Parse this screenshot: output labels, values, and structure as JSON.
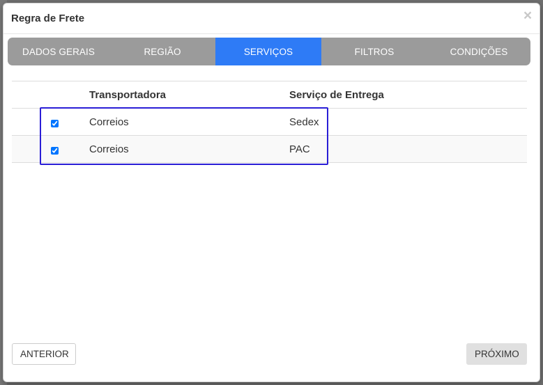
{
  "modal": {
    "title": "Regra de Frete",
    "close_label": "×"
  },
  "tabs": [
    {
      "label": "DADOS GERAIS",
      "active": false
    },
    {
      "label": "REGIÃO",
      "active": false
    },
    {
      "label": "SERVIÇOS",
      "active": true
    },
    {
      "label": "FILTROS",
      "active": false
    },
    {
      "label": "CONDIÇÕES",
      "active": false
    }
  ],
  "table": {
    "headers": [
      "",
      "Transportadora",
      "Serviço de Entrega"
    ],
    "rows": [
      {
        "checked": true,
        "carrier": "Correios",
        "service": "Sedex"
      },
      {
        "checked": true,
        "carrier": "Correios",
        "service": "PAC"
      }
    ]
  },
  "footer": {
    "prev_label": "ANTERIOR",
    "next_label": "PRÓXIMO"
  },
  "colors": {
    "tab_active": "#2e7bf6",
    "tab_bar": "#9b9b9b",
    "highlight_box": "#2a1ed6",
    "backdrop": "#6f6f6f"
  }
}
